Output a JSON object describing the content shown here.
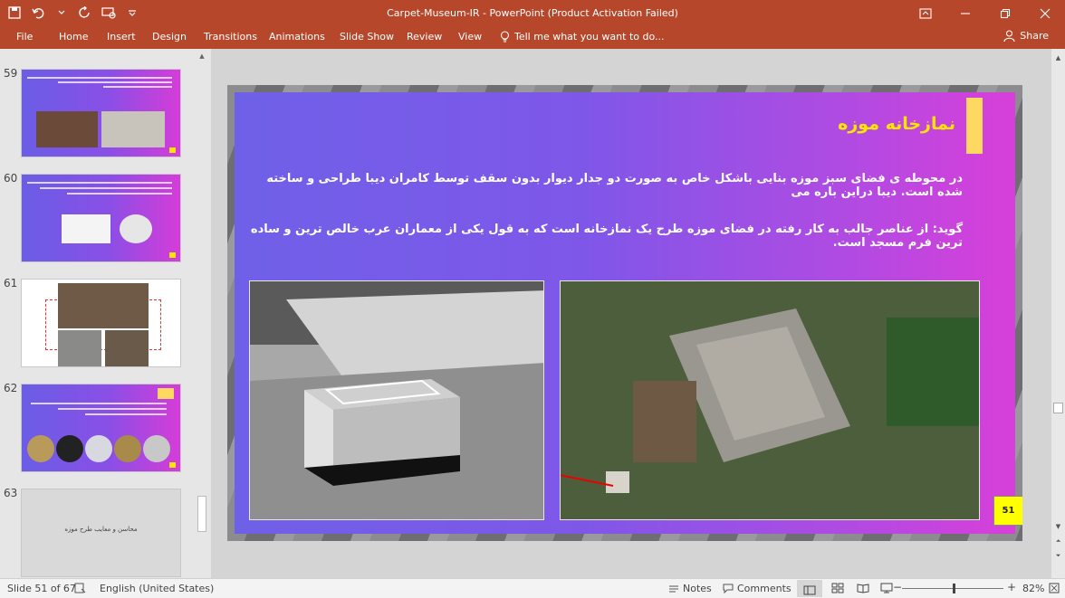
{
  "window": {
    "title": "Carpet-Museum-IR - PowerPoint (Product Activation Failed)"
  },
  "ribbon": {
    "file": "File",
    "tabs": [
      "Home",
      "Insert",
      "Design",
      "Transitions",
      "Animations",
      "Slide Show",
      "Review",
      "View"
    ],
    "tell_me": "Tell me what you want to do...",
    "share": "Share"
  },
  "thumbnails": {
    "numbers": [
      "59",
      "60",
      "61",
      "62",
      "63"
    ],
    "slide63_text": "محاسن و معایب طرح موزه"
  },
  "slide": {
    "title": "نمازخانه موزه",
    "body_line1": "در محوطه ی فضای سبز موزه بنایی باشکل خاص به صورت دو جدار دیوار بدون سقف توسط کامران دیبا طراحی و ساخته شده است. دیبا دراین باره می",
    "body_line2": "گوید:  از عناصر جالب به کار رفته در فضای موزه طرح یک نمازخانه است که به قول یکی از معماران عرب خالص ترین و ساده ترین فرم مسجد است.",
    "page_number": "51"
  },
  "statusbar": {
    "slide_info": "Slide 51 of 67",
    "language": "English (United States)",
    "notes": "Notes",
    "comments": "Comments",
    "zoom": "82%"
  },
  "colors": {
    "accent": "#b7472a",
    "slide_title": "#ffe600",
    "badge": "#ffff00"
  }
}
